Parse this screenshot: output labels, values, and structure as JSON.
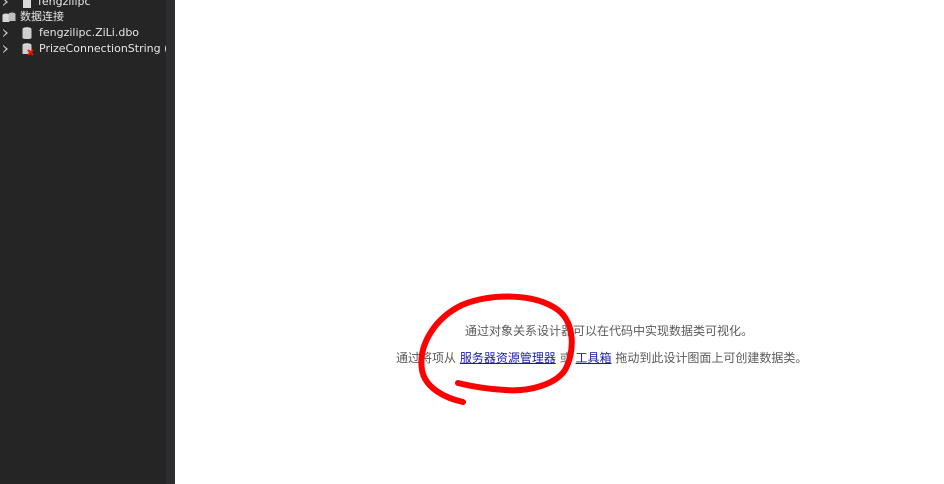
{
  "explorer": {
    "items": [
      {
        "label": "fengzilipc",
        "expandable": true,
        "icon": "server-icon"
      },
      {
        "label": "数据连接",
        "expandable": false,
        "icon": "data-connections-icon"
      },
      {
        "label": "fengzilipc.ZiLi.dbo",
        "expandable": true,
        "icon": "database-icon"
      },
      {
        "label": "PrizeConnectionString (We",
        "expandable": true,
        "icon": "database-error-icon"
      }
    ]
  },
  "designer": {
    "line1": "通过对象关系设计器可以在代码中实现数据类可视化。",
    "line2_prefix": "通过将项从",
    "server_explorer_link": "服务器资源管理器",
    "line2_or": "或",
    "toolbox_link": "工具箱",
    "line2_suffix": "拖动到此设计图面上可创建数据类。"
  },
  "colors": {
    "explorer_bg": "#252526",
    "annotation": "#ff0000",
    "link": "#1a1aa6"
  }
}
